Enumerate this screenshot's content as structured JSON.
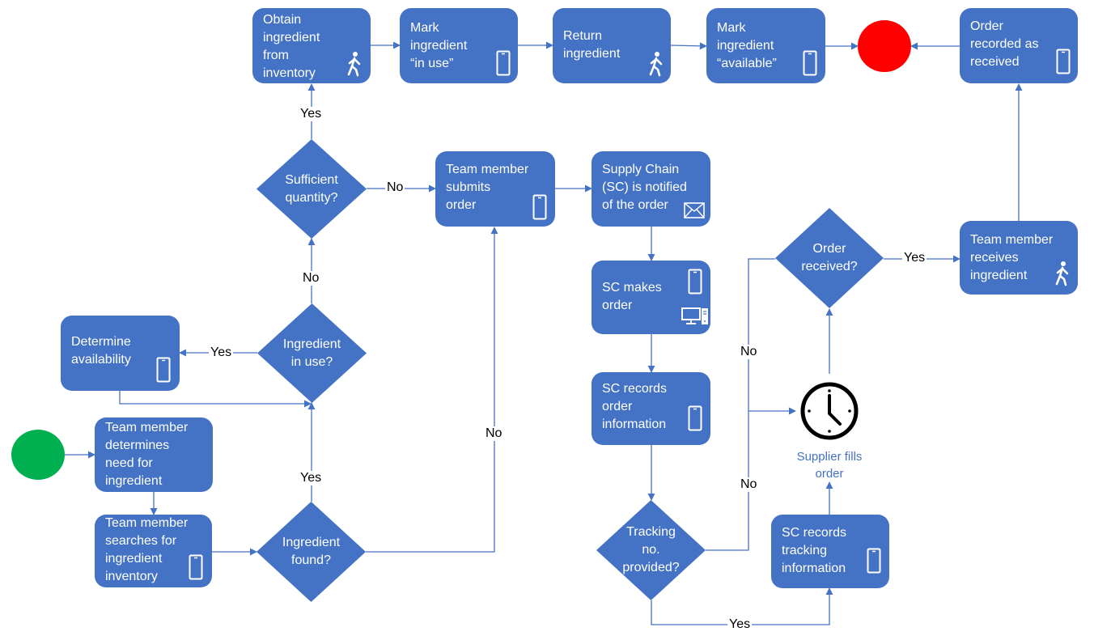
{
  "colors": {
    "node": "#4472c4",
    "edge": "#4472c4",
    "start": "#00b050",
    "end": "#ff0000",
    "label": "#000000",
    "caption": "#4472c4"
  },
  "terminals": {
    "start": "start",
    "end": "end"
  },
  "nodes": {
    "obtain": "Obtain\ningredient\nfrom\ninventory",
    "mark_in_use": "Mark\ningredient\n“in use”",
    "return": "Return\ningredient",
    "mark_available": "Mark\ningredient\n“available”",
    "order_recorded": "Order\nrecorded as\nreceived",
    "submit_order": "Team member\nsubmits\norder",
    "sc_notified": "Supply Chain\n(SC) is notified\nof the order",
    "sc_makes": "SC makes\norder",
    "sc_records_order": "SC records\norder\ninformation",
    "determine_availability": "Determine\navailability",
    "determine_need": "Team member\ndetermines\nneed for\ningredient",
    "search_inventory": "Team member\nsearches for\ningredient\ninventory",
    "receives": "Team member\nreceives\ningredient",
    "sc_records_tracking": "SC records\ntracking\ninformation"
  },
  "decisions": {
    "sufficient": "Sufficient\nquantity?",
    "in_use": "Ingredient\nin use?",
    "found": "Ingredient\nfound?",
    "order_received": "Order\nreceived?",
    "tracking": "Tracking\nno.\nprovided?"
  },
  "labels": {
    "yes_obtain": "Yes",
    "no_sufficient": "No",
    "no_in_use": "No",
    "yes_in_use": "Yes",
    "yes_found": "Yes",
    "no_found": "No",
    "yes_received": "Yes",
    "no_received": "No",
    "no_tracking": "No",
    "yes_tracking": "Yes"
  },
  "wait": {
    "caption": "Supplier fills\norder",
    "icon": "clock-icon"
  },
  "icons": {
    "phone": "phone-icon",
    "walk": "walking-person-icon",
    "mail": "envelope-icon",
    "desktop": "desktop-computer-icon"
  }
}
